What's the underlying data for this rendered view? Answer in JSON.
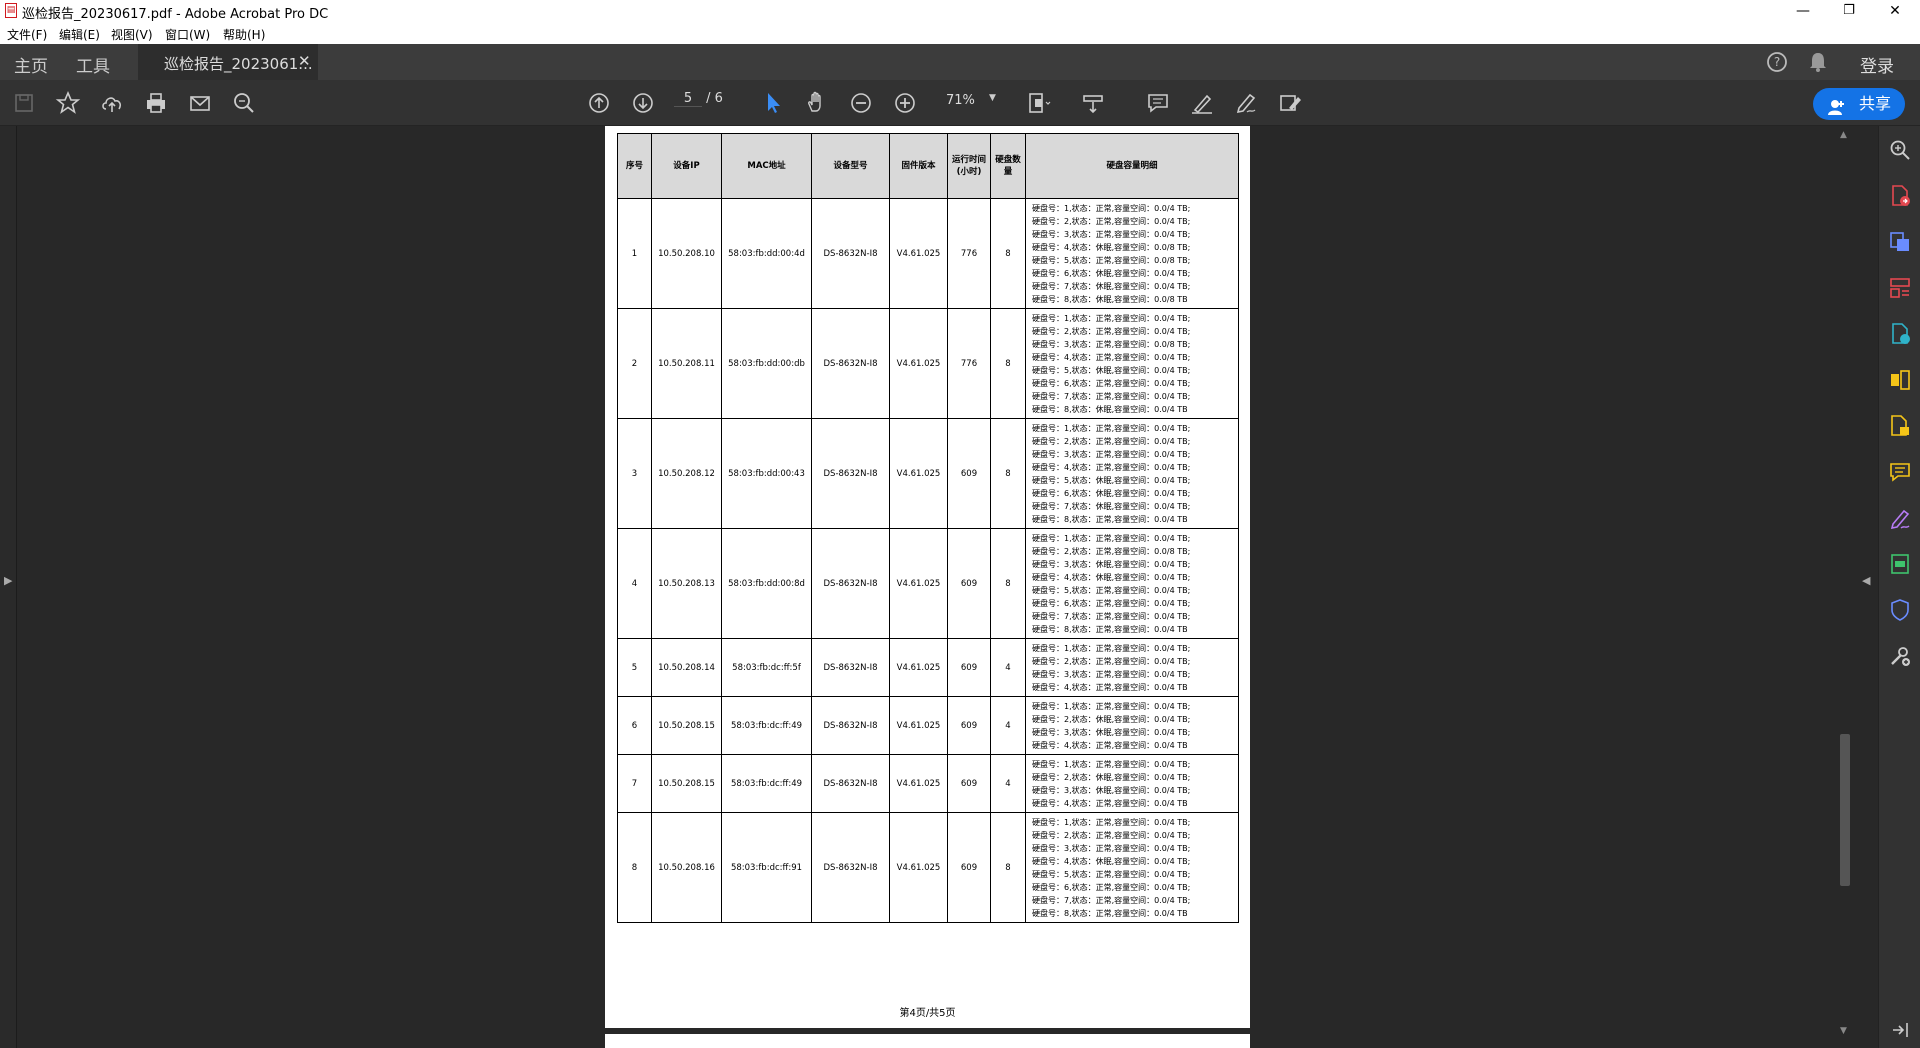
{
  "window": {
    "title": "巡检报告_20230617.pdf - Adobe Acrobat Pro DC",
    "minimize": "—",
    "restore": "❐",
    "close": "✕"
  },
  "menu": [
    "文件(F)",
    "编辑(E)",
    "视图(V)",
    "窗口(W)",
    "帮助(H)"
  ],
  "nav": {
    "home": "主页",
    "tools": "工具",
    "doc_tab": "巡检报告_2023061...",
    "login": "登录"
  },
  "toolbar": {
    "current_page": "5",
    "total_pages": "/ 6",
    "zoom": "71%",
    "share": "共享"
  },
  "table": {
    "headers": [
      "序号",
      "设备IP",
      "MAC地址",
      "设备型号",
      "固件版本",
      "运行时间(小时)",
      "硬盘数量",
      "硬盘容量明细"
    ],
    "rows": [
      {
        "no": "1",
        "ip": "10.50.208.10",
        "mac": "58:03:fb:dd:00:4d",
        "model": "DS-8632N-I8",
        "fw": "V4.61.025",
        "uptime": "776",
        "disks": "8",
        "detail": [
          "硬盘号：1,状态：正常,容量空间：0.0/4 TB;",
          "硬盘号：2,状态：正常,容量空间：0.0/4 TB;",
          "硬盘号：3,状态：正常,容量空间：0.0/4 TB;",
          "硬盘号：4,状态：休眠,容量空间：0.0/8 TB;",
          "硬盘号：5,状态：正常,容量空间：0.0/8 TB;",
          "硬盘号：6,状态：休眠,容量空间：0.0/4 TB;",
          "硬盘号：7,状态：休眠,容量空间：0.0/4 TB;",
          "硬盘号：8,状态：休眠,容量空间：0.0/8 TB"
        ]
      },
      {
        "no": "2",
        "ip": "10.50.208.11",
        "mac": "58:03:fb:dd:00:db",
        "model": "DS-8632N-I8",
        "fw": "V4.61.025",
        "uptime": "776",
        "disks": "8",
        "detail": [
          "硬盘号：1,状态：正常,容量空间：0.0/4 TB;",
          "硬盘号：2,状态：正常,容量空间：0.0/4 TB;",
          "硬盘号：3,状态：正常,容量空间：0.0/8 TB;",
          "硬盘号：4,状态：正常,容量空间：0.0/4 TB;",
          "硬盘号：5,状态：休眠,容量空间：0.0/4 TB;",
          "硬盘号：6,状态：正常,容量空间：0.0/4 TB;",
          "硬盘号：7,状态：正常,容量空间：0.0/4 TB;",
          "硬盘号：8,状态：休眠,容量空间：0.0/4 TB"
        ]
      },
      {
        "no": "3",
        "ip": "10.50.208.12",
        "mac": "58:03:fb:dd:00:43",
        "model": "DS-8632N-I8",
        "fw": "V4.61.025",
        "uptime": "609",
        "disks": "8",
        "detail": [
          "硬盘号：1,状态：正常,容量空间：0.0/4 TB;",
          "硬盘号：2,状态：正常,容量空间：0.0/4 TB;",
          "硬盘号：3,状态：正常,容量空间：0.0/4 TB;",
          "硬盘号：4,状态：正常,容量空间：0.0/4 TB;",
          "硬盘号：5,状态：休眠,容量空间：0.0/4 TB;",
          "硬盘号：6,状态：休眠,容量空间：0.0/4 TB;",
          "硬盘号：7,状态：休眠,容量空间：0.0/4 TB;",
          "硬盘号：8,状态：正常,容量空间：0.0/4 TB"
        ]
      },
      {
        "no": "4",
        "ip": "10.50.208.13",
        "mac": "58:03:fb:dd:00:8d",
        "model": "DS-8632N-I8",
        "fw": "V4.61.025",
        "uptime": "609",
        "disks": "8",
        "detail": [
          "硬盘号：1,状态：正常,容量空间：0.0/4 TB;",
          "硬盘号：2,状态：正常,容量空间：0.0/8 TB;",
          "硬盘号：3,状态：休眠,容量空间：0.0/4 TB;",
          "硬盘号：4,状态：休眠,容量空间：0.0/4 TB;",
          "硬盘号：5,状态：正常,容量空间：0.0/4 TB;",
          "硬盘号：6,状态：正常,容量空间：0.0/4 TB;",
          "硬盘号：7,状态：正常,容量空间：0.0/4 TB;",
          "硬盘号：8,状态：正常,容量空间：0.0/4 TB"
        ]
      },
      {
        "no": "5",
        "ip": "10.50.208.14",
        "mac": "58:03:fb:dc:ff:5f",
        "model": "DS-8632N-I8",
        "fw": "V4.61.025",
        "uptime": "609",
        "disks": "4",
        "detail": [
          "硬盘号：1,状态：正常,容量空间：0.0/4 TB;",
          "硬盘号：2,状态：正常,容量空间：0.0/4 TB;",
          "硬盘号：3,状态：正常,容量空间：0.0/4 TB;",
          "硬盘号：4,状态：正常,容量空间：0.0/4 TB"
        ]
      },
      {
        "no": "6",
        "ip": "10.50.208.15",
        "mac": "58:03:fb:dc:ff:49",
        "model": "DS-8632N-I8",
        "fw": "V4.61.025",
        "uptime": "609",
        "disks": "4",
        "detail": [
          "硬盘号：1,状态：正常,容量空间：0.0/4 TB;",
          "硬盘号：2,状态：休眠,容量空间：0.0/4 TB;",
          "硬盘号：3,状态：休眠,容量空间：0.0/4 TB;",
          "硬盘号：4,状态：正常,容量空间：0.0/4 TB"
        ]
      },
      {
        "no": "7",
        "ip": "10.50.208.15",
        "mac": "58:03:fb:dc:ff:49",
        "model": "DS-8632N-I8",
        "fw": "V4.61.025",
        "uptime": "609",
        "disks": "4",
        "detail": [
          "硬盘号：1,状态：正常,容量空间：0.0/4 TB;",
          "硬盘号：2,状态：休眠,容量空间：0.0/4 TB;",
          "硬盘号：3,状态：休眠,容量空间：0.0/4 TB;",
          "硬盘号：4,状态：正常,容量空间：0.0/4 TB"
        ]
      },
      {
        "no": "8",
        "ip": "10.50.208.16",
        "mac": "58:03:fb:dc:ff:91",
        "model": "DS-8632N-I8",
        "fw": "V4.61.025",
        "uptime": "609",
        "disks": "8",
        "detail": [
          "硬盘号：1,状态：正常,容量空间：0.0/4 TB;",
          "硬盘号：2,状态：正常,容量空间：0.0/4 TB;",
          "硬盘号：3,状态：正常,容量空间：0.0/4 TB;",
          "硬盘号：4,状态：休眠,容量空间：0.0/4 TB;",
          "硬盘号：5,状态：正常,容量空间：0.0/4 TB;",
          "硬盘号：6,状态：正常,容量空间：0.0/4 TB;",
          "硬盘号：7,状态：正常,容量空间：0.0/4 TB;",
          "硬盘号：8,状态：正常,容量空间：0.0/4 TB"
        ]
      }
    ]
  },
  "footer": "第4页/共5页",
  "colors": {
    "accent": "#1473e6",
    "toolbar_bg": "#323232",
    "viewer_bg": "#282828"
  },
  "icons": {
    "toolbar": [
      "save-icon",
      "bookmark-star-icon",
      "upload-cloud-icon",
      "print-icon",
      "email-icon",
      "search-zoom-icon",
      "page-up-icon",
      "page-down-icon",
      "select-pointer-icon",
      "hand-icon",
      "zoom-out-icon",
      "zoom-in-icon",
      "page-layout-icon",
      "scroll-mode-icon",
      "comment-icon",
      "highlight-pen-icon",
      "sign-icon",
      "redact-icon"
    ],
    "right_panel": [
      "search-icon",
      "export-pdf-icon",
      "create-pdf-icon",
      "organize-pages-icon",
      "edit-pdf-icon",
      "combine-files-icon",
      "fill-sign-icon",
      "comment-tool-icon",
      "draw-tool-icon",
      "print-production-icon",
      "protect-icon",
      "more-tools-icon"
    ]
  }
}
